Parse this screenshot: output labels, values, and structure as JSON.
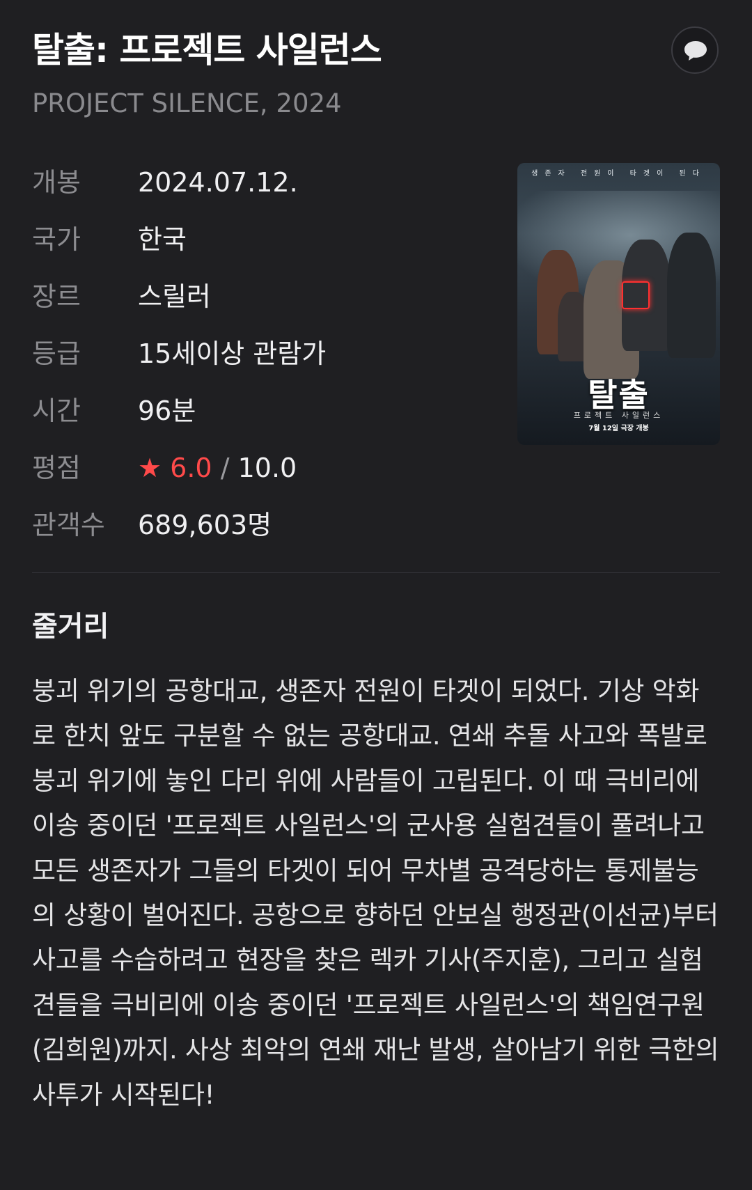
{
  "movie": {
    "title": "탈출: 프로젝트 사일런스",
    "original_title_year": "PROJECT SILENCE, 2024"
  },
  "actions": {
    "comment_icon": "speech-bubble-icon"
  },
  "info": {
    "release": {
      "label": "개봉",
      "value": "2024.07.12."
    },
    "country": {
      "label": "국가",
      "value": "한국"
    },
    "genre": {
      "label": "장르",
      "value": "스릴러"
    },
    "rating_grade": {
      "label": "등급",
      "value": "15세이상 관람가"
    },
    "runtime": {
      "label": "시간",
      "value": "96분"
    },
    "score": {
      "label": "평점",
      "star": "★",
      "value": "6.0",
      "separator": "/",
      "max": "10.0"
    },
    "audience": {
      "label": "관객수",
      "value": "689,603명"
    }
  },
  "poster": {
    "tagline": "생존자 전원이 타겟이 된다",
    "title": "탈출",
    "subtitle": "프로젝트 사일런스",
    "release_note": "7월 12일 극장 개봉"
  },
  "synopsis": {
    "heading": "줄거리",
    "text": "붕괴 위기의 공항대교, 생존자 전원이 타겟이 되었다. 기상 악화로 한치 앞도 구분할 수 없는 공항대교. 연쇄 추돌 사고와 폭발로 붕괴 위기에 놓인 다리 위에 사람들이 고립된다. 이 때 극비리에 이송 중이던 '프로젝트 사일런스'의 군사용 실험견들이 풀려나고 모든 생존자가 그들의 타겟이 되어 무차별 공격당하는 통제불능의 상황이 벌어진다. 공항으로 향하던 안보실 행정관(이선균)부터 사고를 수습하려고 현장을 찾은 렉카 기사(주지훈), 그리고 실험견들을 극비리에 이송 중이던 '프로젝트 사일런스'의 책임연구원(김희원)까지. 사상 최악의 연쇄 재난 발생, 살아남기 위한 극한의 사투가 시작된다!"
  },
  "colors": {
    "background": "#1f1f22",
    "label": "#8c8c90",
    "accent_red": "#ff4a4a"
  }
}
